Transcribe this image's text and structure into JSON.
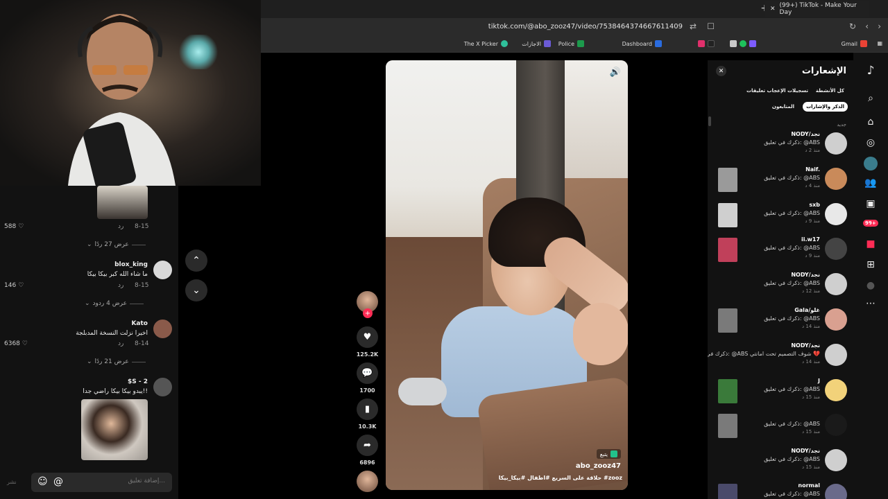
{
  "browser": {
    "tab_title": "(99+) TikTok - Make Your Day",
    "url": "tiktok.com/@abo_zooz47/video/7538464374667611409",
    "bookmarks": [
      "Gmail",
      "Dashboard",
      "Police",
      "الاجازات",
      "The X Picker"
    ]
  },
  "comments_panel": {
    "items": [
      {
        "username": "",
        "text": "",
        "date": "8-15",
        "reply_label": "رد",
        "likes": "588",
        "view_replies": "عرض 27 ردًا"
      },
      {
        "username": "blox_king",
        "text": "ما شاء الله كبر بيكا بيكا",
        "date": "8-15",
        "reply_label": "رد",
        "likes": "146",
        "view_replies": "عرض 4 ردود"
      },
      {
        "username": "Kato",
        "text": "اخيرا نزلت النسخة المدبلجة",
        "date": "8-14",
        "reply_label": "رد",
        "likes": "6368",
        "view_replies": "عرض 21 ردًا"
      },
      {
        "username": "$S - 2",
        "text": "يبدو بيكا بيكا راضي جدا!!",
        "date": "",
        "reply_label": "",
        "likes": "",
        "view_replies": ""
      }
    ],
    "input_placeholder": "إضافة تعليق...",
    "post_label": "نشر"
  },
  "video": {
    "author": "abo_zooz47",
    "caption": "حلاقة على السريع #اطفال #بيكا_بيكا #zooz",
    "follow_label": "يتبع",
    "likes": "125.2K",
    "comments": "1700",
    "saves": "10.3K",
    "shares": "6896"
  },
  "notifications": {
    "title": "الإشعارات",
    "filters": [
      "كل الأنشطة",
      "تسجيلات الإعجاب",
      "تعليقات",
      "الذكر والإشارات",
      "المتابعون"
    ],
    "active_filter": "الذكر والإشارات",
    "section_label": "جديد",
    "items": [
      {
        "name": "NODY/نجد",
        "text": "ذكرك في تعليق: @ABS",
        "time": "منذ 2 د",
        "avatar_color": "#cfcfcf"
      },
      {
        "name": "Naif.",
        "text": "ذكرك في تعليق: @ABS",
        "time": "منذ 4 د",
        "avatar_color": "#c98a5a"
      },
      {
        "name": "sxb",
        "text": "ذكرك في تعليق: @ABS",
        "time": "منذ 9 د",
        "avatar_color": "#e8e8e8"
      },
      {
        "name": "ii.w17",
        "text": "ذكرك في تعليق: @ABS",
        "time": "منذ 9 د",
        "avatar_color": "#444444"
      },
      {
        "name": "NODY/نجد",
        "text": "ذكرك في تعليق: @ABS",
        "time": "منذ 12 د",
        "avatar_color": "#cfcfcf"
      },
      {
        "name": "Gala/غلو",
        "text": "ذكرك في تعليق: @ABS",
        "time": "منذ 14 د",
        "avatar_color": "#d9a090"
      },
      {
        "name": "NODY/نجد",
        "text": "ذكرك في تعليق: @ABS شوف التصميم تحت امانتي 💔",
        "time": "منذ 14 د",
        "avatar_color": "#cfcfcf"
      },
      {
        "name": "J",
        "text": "ذكرك في تعليق: @ABS",
        "time": "منذ 15 د",
        "avatar_color": "#f2d27a"
      },
      {
        "name": "",
        "text": "ذكرك في تعليق: @ABS",
        "time": "منذ 15 د",
        "avatar_color": "#1a1a1a"
      },
      {
        "name": "NODY/نجد",
        "text": "ذكرك في تعليق: @ABS",
        "time": "منذ 15 د",
        "avatar_color": "#cfcfcf"
      },
      {
        "name": "normal",
        "text": "ذكرك في تعليق: @ABS",
        "time": "",
        "avatar_color": "#6a6a8a"
      }
    ]
  },
  "sidebar": {
    "notification_badge": "99+"
  },
  "colors": {
    "accent": "#fe2c55",
    "panel": "#121212"
  }
}
